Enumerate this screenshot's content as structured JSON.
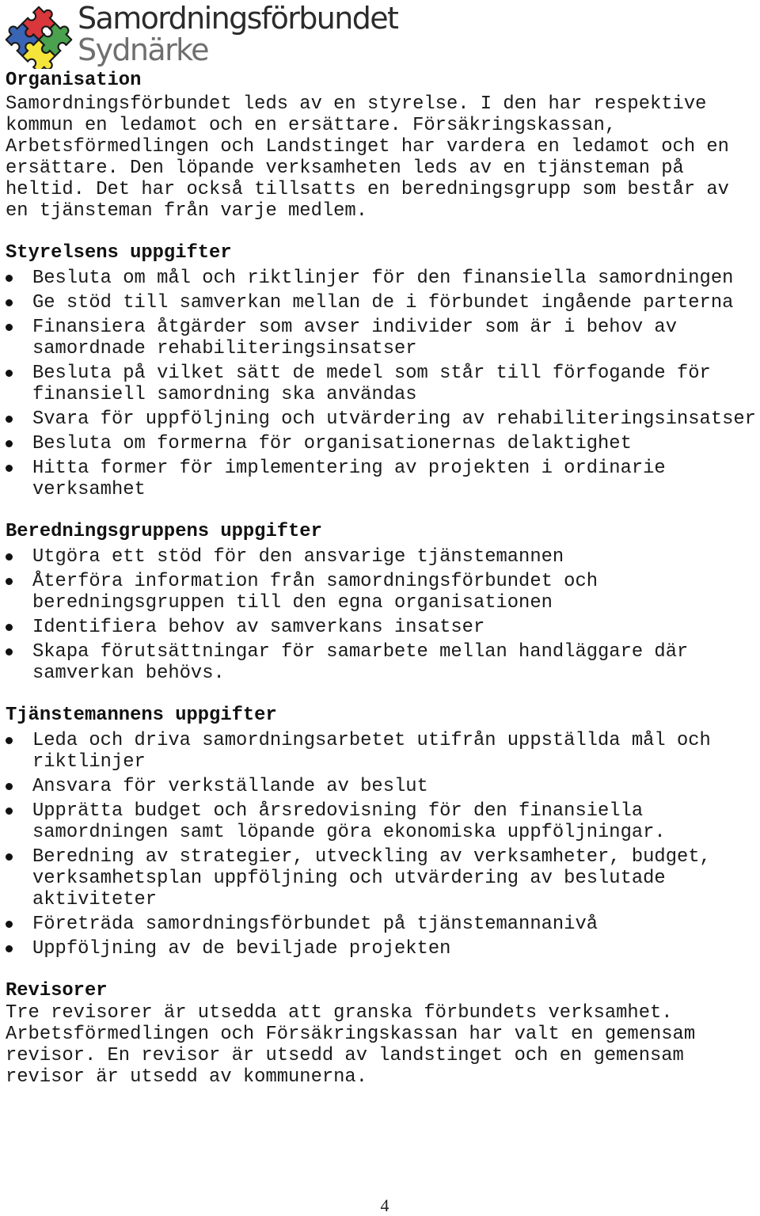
{
  "logo": {
    "icon": "puzzle-pieces-icon",
    "line1": "Samordningsförbundet",
    "line2": "Sydnärke",
    "colors": {
      "red": "#d9373b",
      "blue": "#3a64b4",
      "green": "#4aa24e",
      "yellow": "#f5e53a"
    }
  },
  "sections": {
    "organisation": {
      "heading": "Organisation",
      "text": "Samordningsförbundet leds av en styrelse. I den har respektive\nkommun en ledamot och en ersättare. Försäkringskassan,\nArbetsförmedlingen och Landstinget har vardera en ledamot och en\nersättare. Den löpande verksamheten leds av en tjänsteman på\nheltid. Det har också tillsatts en beredningsgrupp som består av\nen tjänsteman från varje medlem."
    },
    "styrelsen": {
      "heading": "Styrelsens uppgifter",
      "items": [
        "Besluta om mål och riktlinjer för den finansiella samordningen",
        "Ge stöd till samverkan mellan de i förbundet ingående parterna",
        "Finansiera åtgärder som avser individer som är i behov av\nsamordnade rehabiliteringsinsatser",
        "Besluta på vilket sätt de medel som står till förfogande för\nfinansiell samordning ska användas",
        "Svara för uppföljning och utvärdering av rehabiliteringsinsatser",
        "Besluta om formerna för organisationernas delaktighet",
        "Hitta former för implementering av projekten i ordinarie\nverksamhet"
      ]
    },
    "beredningsgruppen": {
      "heading": "Beredningsgruppens uppgifter",
      "items": [
        "Utgöra ett stöd för den ansvarige tjänstemannen",
        "Återföra information från samordningsförbundet och\nberedningsgruppen till den egna organisationen",
        "Identifiera behov av samverkans insatser",
        "Skapa förutsättningar för samarbete mellan handläggare där\nsamverkan behövs."
      ]
    },
    "tjanstemannen": {
      "heading": "Tjänstemannens uppgifter",
      "items": [
        "Leda och driva samordningsarbetet utifrån uppställda mål och\nriktlinjer",
        "Ansvara för verkställande av beslut",
        "Upprätta budget och årsredovisning för den finansiella\nsamordningen samt löpande göra ekonomiska uppföljningar.",
        "Beredning av strategier, utveckling av verksamheter, budget,\nverksamhetsplan uppföljning och utvärdering av beslutade\naktiviteter",
        "Företräda samordningsförbundet på tjänstemannanivå",
        "Uppföljning av de beviljade projekten"
      ]
    },
    "revisorer": {
      "heading": "Revisorer",
      "text": "Tre revisorer är utsedda att granska förbundets verksamhet.\nArbetsförmedlingen och Försäkringskassan har valt en gemensam\nrevisor. En revisor är utsedd av landstinget och en gemensam\nrevisor är utsedd av kommunerna."
    }
  },
  "footer": {
    "page_number": "4"
  }
}
